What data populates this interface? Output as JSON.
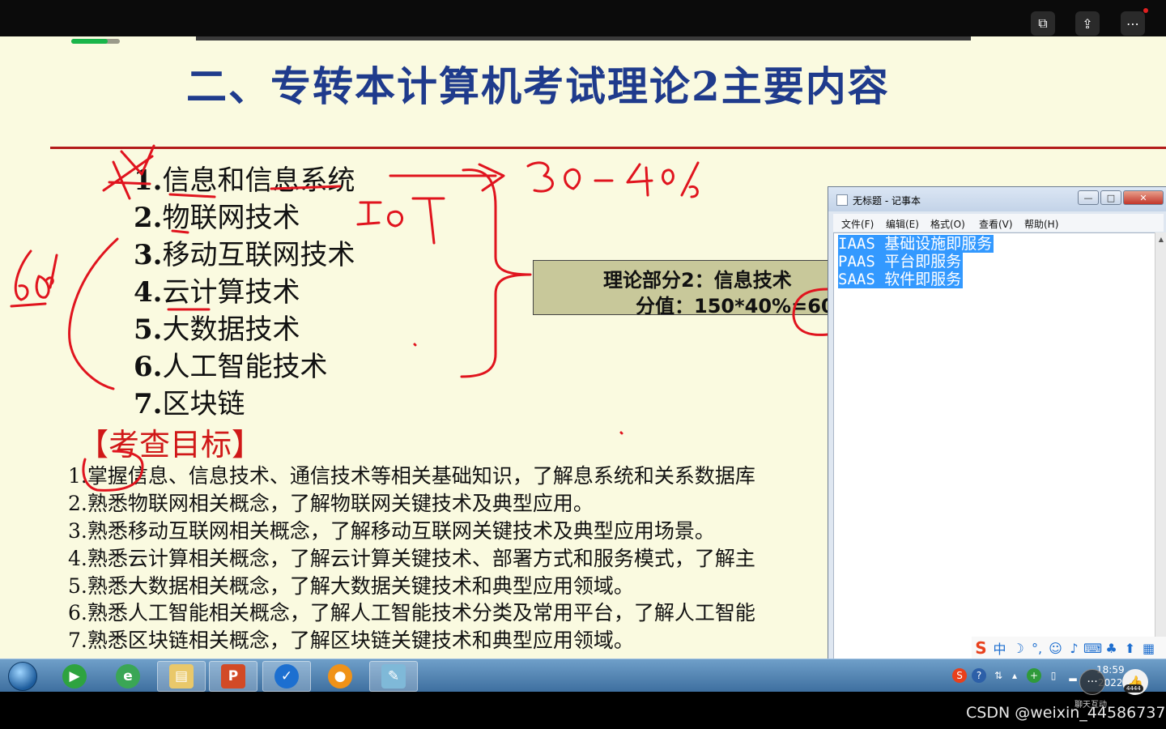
{
  "slide": {
    "title": "二、专转本计算机考试理论2主要内容",
    "topics": [
      {
        "num": "1.",
        "text": "信息和信息系统"
      },
      {
        "num": "2.",
        "text": "物联网技术"
      },
      {
        "num": "3.",
        "text": "移动互联网技术"
      },
      {
        "num": "4.",
        "text": "云计算技术"
      },
      {
        "num": "5.",
        "text": "大数据技术"
      },
      {
        "num": "6.",
        "text": "人工智能技术"
      },
      {
        "num": "7.",
        "text": "区块链"
      }
    ],
    "theory_box": {
      "line1": "理论部分2：信息技术",
      "line2": "分值：150*40%=60"
    },
    "goals_heading": "【考查目标】",
    "goals": [
      "1.掌握信息、信息技术、通信技术等相关基础知识，了解息系统和关系数据库",
      "2.熟悉物联网相关概念，了解物联网关键技术及典型应用。",
      "3.熟悉移动互联网相关概念，了解移动互联网关键技术及典型应用场景。",
      "4.熟悉云计算相关概念，了解云计算关键技术、部署方式和服务模式，了解主",
      "5.熟悉大数据相关概念，了解大数据关键技术和典型应用领域。",
      "6.熟悉人工智能相关概念，了解人工智能技术分类及常用平台，了解人工智能",
      "7.熟悉区块链相关概念，了解区块链关键技术和典型应用领域。"
    ],
    "progress": 0.75,
    "ink_color": "#e0141e"
  },
  "notepad": {
    "title": "无标题 - 记事本",
    "menus": [
      "文件(F)",
      "编辑(E)",
      "格式(O)",
      "查看(V)",
      "帮助(H)"
    ],
    "lines": [
      "IAAS 基础设施即服务",
      "PAAS 平台即服务",
      "SAAS 软件即服务"
    ],
    "controls": {
      "minimize": "—",
      "maximize": "□",
      "close": "✕"
    }
  },
  "taskbar": {
    "tray_time": "18:59",
    "tray_date": "2022"
  },
  "overlay": {
    "chat_label": "聊天互动",
    "like_count": "4444",
    "watermark": "CSDN @weixin_44586737"
  },
  "icons": {
    "start": "windows-start-orb",
    "tb1": "media-player-icon",
    "tb2": "ie-browser-icon",
    "tb3": "file-explorer-icon",
    "tb4": "powerpoint-icon",
    "tb5": "feishu-icon",
    "tb6": "recorder-icon",
    "tb7": "notepad-icon"
  }
}
